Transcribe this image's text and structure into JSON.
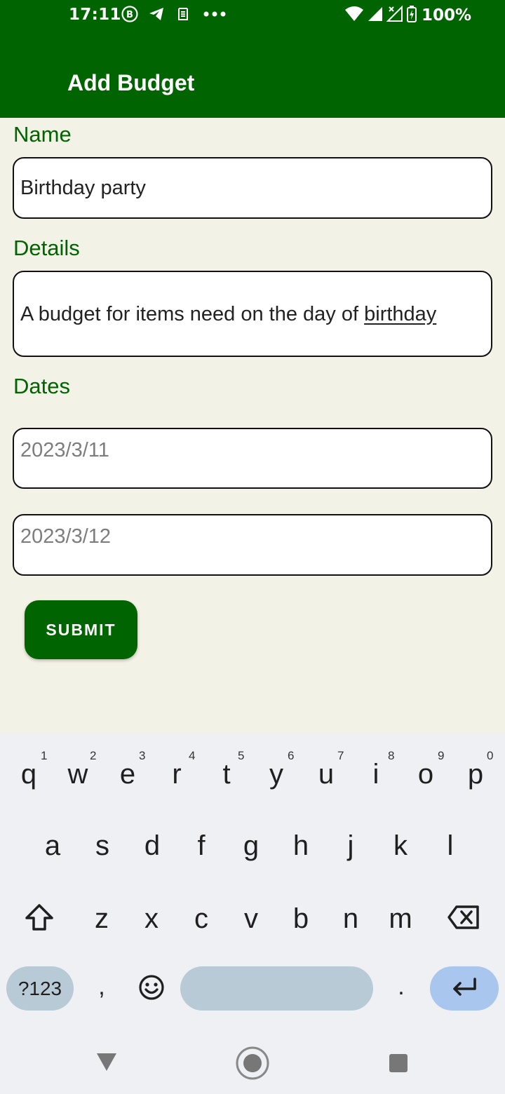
{
  "status_bar": {
    "time": "17:11",
    "battery": "100%",
    "left_icons": [
      "b-badge-icon",
      "telegram-icon",
      "notification-icon",
      "more-dots-icon"
    ],
    "right_icons": [
      "wifi-icon",
      "signal-icon",
      "signal-x-icon",
      "battery-charging-icon"
    ]
  },
  "app_bar": {
    "title": "Add Budget",
    "color": "#006400"
  },
  "form": {
    "name_label": "Name",
    "name_value": "Birthday party",
    "details_label": "Details",
    "details_value_prefix": "A budget for items need on the day of ",
    "details_value_underlined": "birthday",
    "dates_label": "Dates",
    "start_date_placeholder": "2023/3/11",
    "end_date_placeholder": "2023/3/12",
    "submit_label": "SUBMIT"
  },
  "keyboard": {
    "row1": [
      "q",
      "w",
      "e",
      "r",
      "t",
      "y",
      "u",
      "i",
      "o",
      "p"
    ],
    "row1_hints": [
      "1",
      "2",
      "3",
      "4",
      "5",
      "6",
      "7",
      "8",
      "9",
      "0"
    ],
    "row2": [
      "a",
      "s",
      "d",
      "f",
      "g",
      "h",
      "j",
      "k",
      "l"
    ],
    "row3": [
      "z",
      "x",
      "c",
      "v",
      "b",
      "n",
      "m"
    ],
    "symbols_label": "?123",
    "comma": ",",
    "period": ".",
    "icons": [
      "shift-icon",
      "backspace-icon",
      "emoji-icon",
      "enter-icon"
    ]
  },
  "nav_bar": {
    "icons": [
      "back-triangle-icon",
      "home-circle-icon",
      "recents-square-icon"
    ]
  },
  "colors": {
    "primary": "#006400",
    "background": "#f3f2e6",
    "keyboard_background": "#eff0f4",
    "keyboard_pill": "#b8cad6",
    "enter_key": "#a9c6ef"
  }
}
